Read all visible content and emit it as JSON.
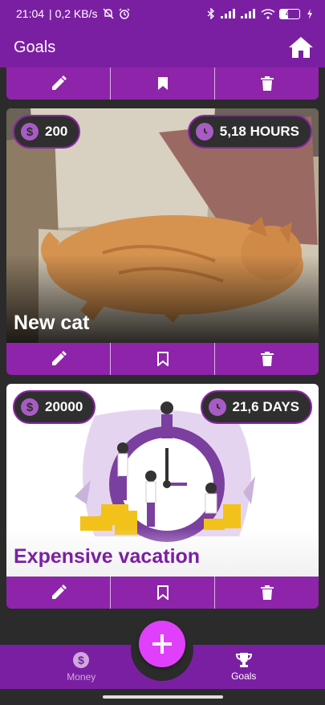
{
  "status_bar": {
    "time": "21:04",
    "network_speed": "| 0,2 KB/s",
    "battery_level": "43",
    "icons": [
      "mute-icon",
      "alarm-icon",
      "bluetooth-icon",
      "signal-icon",
      "signal-icon",
      "wifi-icon",
      "battery-icon",
      "charging-icon"
    ]
  },
  "app_bar": {
    "title": "Goals",
    "home_icon": "home-icon"
  },
  "goals": [
    {
      "title": "New cat",
      "price": "200",
      "time_needed": "5,18 HOURS",
      "image": "cat"
    },
    {
      "title": "Expensive vacation",
      "price": "20000",
      "time_needed": "21,6 DAYS",
      "image": "clock"
    }
  ],
  "actions": [
    "edit-icon",
    "bookmark-icon",
    "delete-icon"
  ],
  "bottom_nav": {
    "money_label": "Money",
    "goals_label": "Goals",
    "selected": "Goals"
  },
  "fab_icon": "plus-icon",
  "colors": {
    "primary": "#7b1fa2",
    "action_bar": "#8e24aa",
    "fab": "#e040fb",
    "background": "#2b2b2b"
  }
}
